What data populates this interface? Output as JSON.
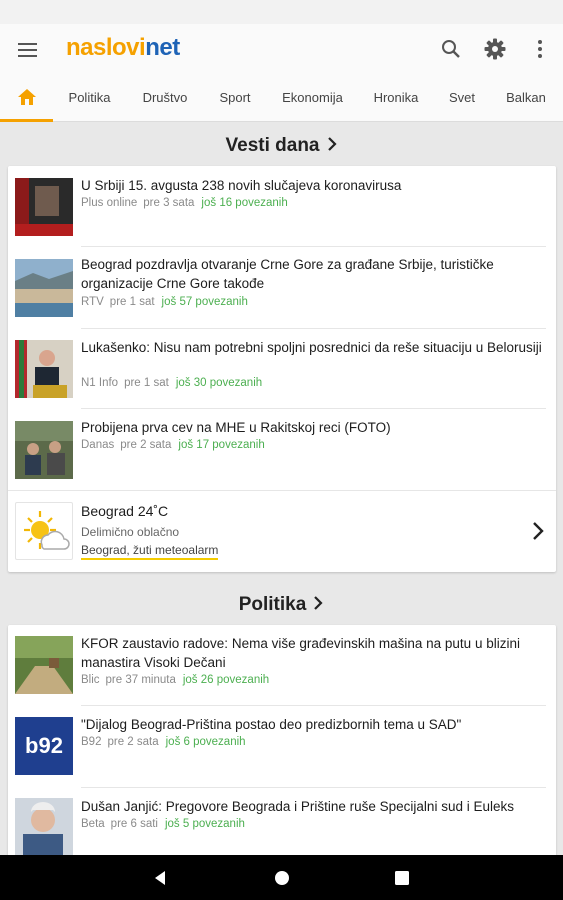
{
  "app": {
    "logo_part_a": "naslovi",
    "logo_part_b": "net"
  },
  "icons": {
    "menu": "hamburger-icon",
    "search": "search-icon",
    "settings": "gear-icon",
    "more": "more-vert-icon",
    "home": "home-icon"
  },
  "tabs": [
    "Politika",
    "Društvo",
    "Sport",
    "Ekonomija",
    "Hronika",
    "Svet",
    "Balkan"
  ],
  "sections": [
    {
      "title": "Vesti dana",
      "items": [
        {
          "title": "U Srbiji 15. avgusta 238 novih slučajeva koronavirusa",
          "source": "Plus online",
          "time": "pre 3 sata",
          "related": "još 16 povezanih"
        },
        {
          "title": "Beograd pozdravlja otvaranje Crne Gore za građane Srbije, turističke organizacije Crne Gore takođe",
          "source": "RTV",
          "time": "pre 1 sat",
          "related": "još 57 povezanih"
        },
        {
          "title": "Lukašenko: Nisu nam potrebni spoljni posrednici da reše situaciju u Belorusiji",
          "source": "N1 Info",
          "time": "pre 1 sat",
          "related": "još 30 povezanih"
        },
        {
          "title": "Probijena prva cev na MHE u Rakitskoj reci (FOTO)",
          "source": "Danas",
          "time": "pre 2 sata",
          "related": "još 17 povezanih"
        }
      ],
      "weather": {
        "city": "Beograd 24˚C",
        "description": "Delimično oblačno",
        "alert": "Beograd, žuti meteoalarm"
      }
    },
    {
      "title": "Politika",
      "items": [
        {
          "title": "KFOR zaustavio radove: Nema više građevinskih mašina na putu u blizini manastira Visoki Dečani",
          "source": "Blic",
          "time": "pre 37 minuta",
          "related": "još 26 povezanih"
        },
        {
          "title": "\"Dijalog Beograd-Priština postao deo predizbornih tema u SAD\"",
          "source": "B92",
          "time": "pre 2 sata",
          "related": "još 6 povezanih",
          "thumb_text": "b92"
        },
        {
          "title": "Dušan Janjić: Pregovore Beograda i Prištine ruše Specijalni sud i Euleks",
          "source": "Beta",
          "time": "pre 6 sati",
          "related": "još 5 povezanih"
        }
      ]
    }
  ],
  "colors": {
    "accent": "#f5a100",
    "brand_blue": "#1e63b6",
    "related_green": "#4caf50",
    "alert_yellow": "#f5cc00"
  }
}
